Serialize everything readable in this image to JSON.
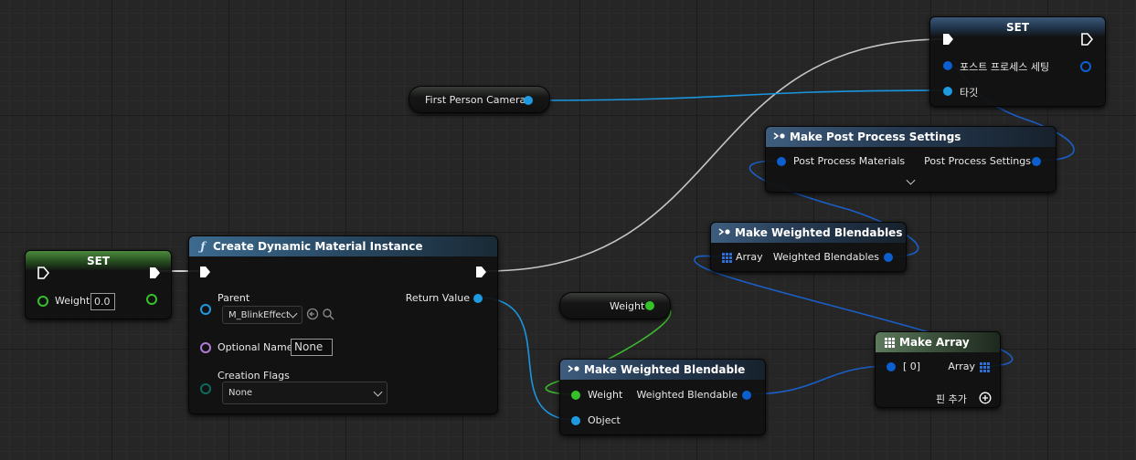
{
  "colors": {
    "exec": "#ffffff",
    "object_pin": "#1e9be0",
    "struct_pin": "#0b5fcf",
    "float_pin": "#36c12b",
    "name_pin": "#b07ad8",
    "byte_pin": "#0a6b5c",
    "struct_wire": "#1a5fc8",
    "float_wire": "#3cb82e",
    "exec_wire": "#c9c9c9"
  },
  "set_weight": {
    "title": "SET",
    "weight_label": "Weight",
    "weight_value": "0.0"
  },
  "create_dmi": {
    "title": "Create Dynamic Material Instance",
    "icon": "function-icon",
    "parent_label": "Parent",
    "parent_value": "M_BlinkEffect",
    "optional_name_label": "Optional Name",
    "optional_name_value": "None",
    "creation_flags_label": "Creation Flags",
    "creation_flags_value": "None",
    "return_label": "Return Value"
  },
  "camera_var": {
    "label": "First Person Camera"
  },
  "weight_var": {
    "label": "Weight"
  },
  "set_post": {
    "title": "SET",
    "settings_label": "포스트 프로세스 세팅",
    "target_label": "타깃"
  },
  "make_pps": {
    "title": "Make Post Process Settings",
    "in_label": "Post Process Materials",
    "out_label": "Post Process Settings"
  },
  "make_wbs": {
    "title": "Make Weighted Blendables",
    "in_label": "Array",
    "out_label": "Weighted Blendables"
  },
  "make_wb": {
    "title": "Make Weighted Blendable",
    "weight_label": "Weight",
    "object_label": "Object",
    "out_label": "Weighted Blendable"
  },
  "make_array": {
    "title": "Make Array",
    "in_label": "[ 0]",
    "out_label": "Array",
    "add_pin_label": "핀 추가"
  }
}
